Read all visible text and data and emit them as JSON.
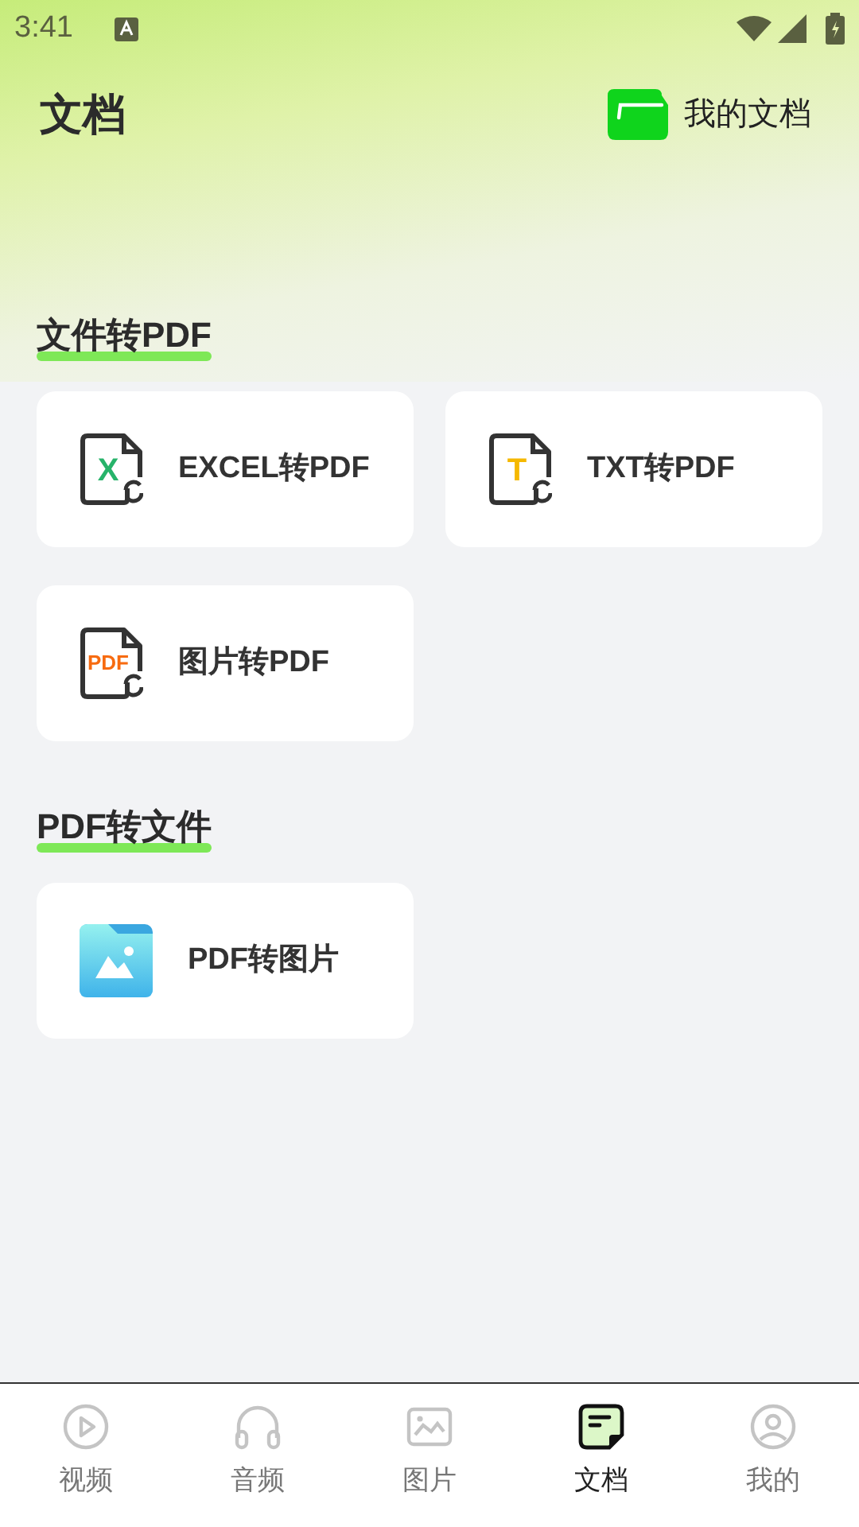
{
  "status_bar": {
    "time": "3:41"
  },
  "header": {
    "title": "文档",
    "action": "我的文档"
  },
  "sections": [
    {
      "title": "文件转PDF",
      "cards": [
        {
          "kind": "excel",
          "badge": "X",
          "label": "EXCEL转PDF"
        },
        {
          "kind": "txt",
          "badge": "T",
          "label": "TXT转PDF"
        },
        {
          "kind": "image",
          "badge": "PDF",
          "label": "图片转PDF"
        }
      ]
    },
    {
      "title": "PDF转文件",
      "cards": [
        {
          "kind": "picture",
          "label": "PDF转图片"
        }
      ]
    }
  ],
  "tabs": [
    {
      "kind": "video",
      "label": "视频",
      "selected": false
    },
    {
      "kind": "audio",
      "label": "音频",
      "selected": false
    },
    {
      "kind": "image",
      "label": "图片",
      "selected": false
    },
    {
      "kind": "doc",
      "label": "文档",
      "selected": true
    },
    {
      "kind": "me",
      "label": "我的",
      "selected": false
    }
  ]
}
